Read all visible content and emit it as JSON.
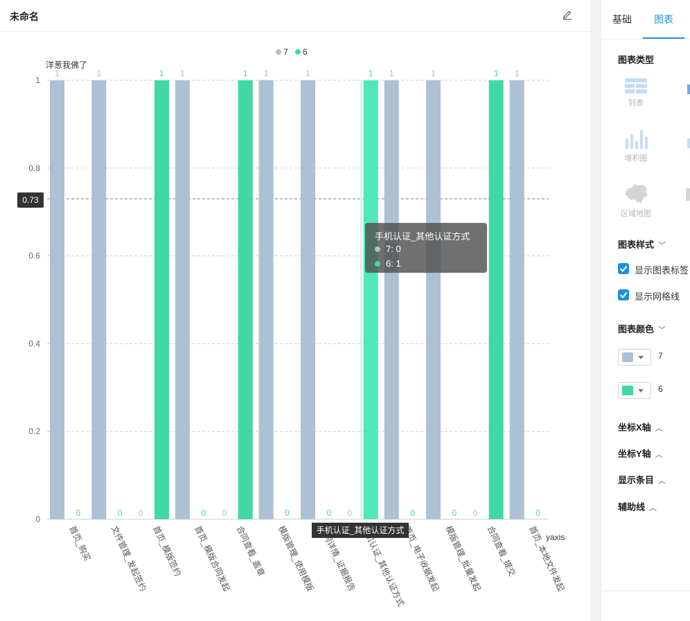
{
  "panel": {
    "title": "未命名"
  },
  "side": {
    "tabs": [
      "基础",
      "图表"
    ],
    "chart_type_title": "图表类型",
    "chart_types": [
      "列表",
      "堆积图",
      "区域地图"
    ],
    "style_title": "图表样式",
    "show_labels": "显示图表标签",
    "show_grid": "显示网格线",
    "color_title": "图表颜色",
    "colors": [
      {
        "name": "7",
        "hex": "#adc0d4"
      },
      {
        "name": "6",
        "hex": "#41d7a7"
      }
    ],
    "x_axis": "坐标X轴",
    "y_axis": "坐标Y轴",
    "display_items": "显示条目",
    "aux_line": "辅助线"
  },
  "tooltip": {
    "title": "手机认证_其他认证方式",
    "rows": [
      {
        "name": "7",
        "value": "0"
      },
      {
        "name": "6",
        "value": "1"
      }
    ]
  },
  "pointer": {
    "y_label": "0.73",
    "x_label": "手机认证_其他认证方式"
  },
  "chart_data": {
    "type": "bar",
    "subtitle": "洋葱我佛了",
    "xlabel": "yaxis",
    "ylim": [
      0,
      1
    ],
    "yticks": [
      "0",
      "0.2",
      "0.4",
      "0.6",
      "0.8",
      "1"
    ],
    "categories": [
      "首页_购买",
      "文件管理_发起签约",
      "首页_模版签约",
      "首页_模版合同发起",
      "合同查看_盖章",
      "模版管理_使用模版",
      "合同详情_证据报告",
      "手机认证_其他认证方式",
      "首页_电子收据发起",
      "模版管理_批量发起",
      "合同查看_提交",
      "首页_本地文件发起"
    ],
    "series": [
      {
        "name": "7",
        "color": "#adc0d4",
        "values": [
          1,
          1,
          0,
          1,
          0,
          1,
          1,
          0,
          1,
          1,
          0,
          1
        ]
      },
      {
        "name": "6",
        "color": "#41d7a7",
        "values": [
          0,
          0,
          1,
          0,
          1,
          0,
          0,
          1,
          0,
          0,
          1,
          0
        ]
      }
    ],
    "highlight_index": 7,
    "grid": true,
    "legend": "top-center"
  }
}
